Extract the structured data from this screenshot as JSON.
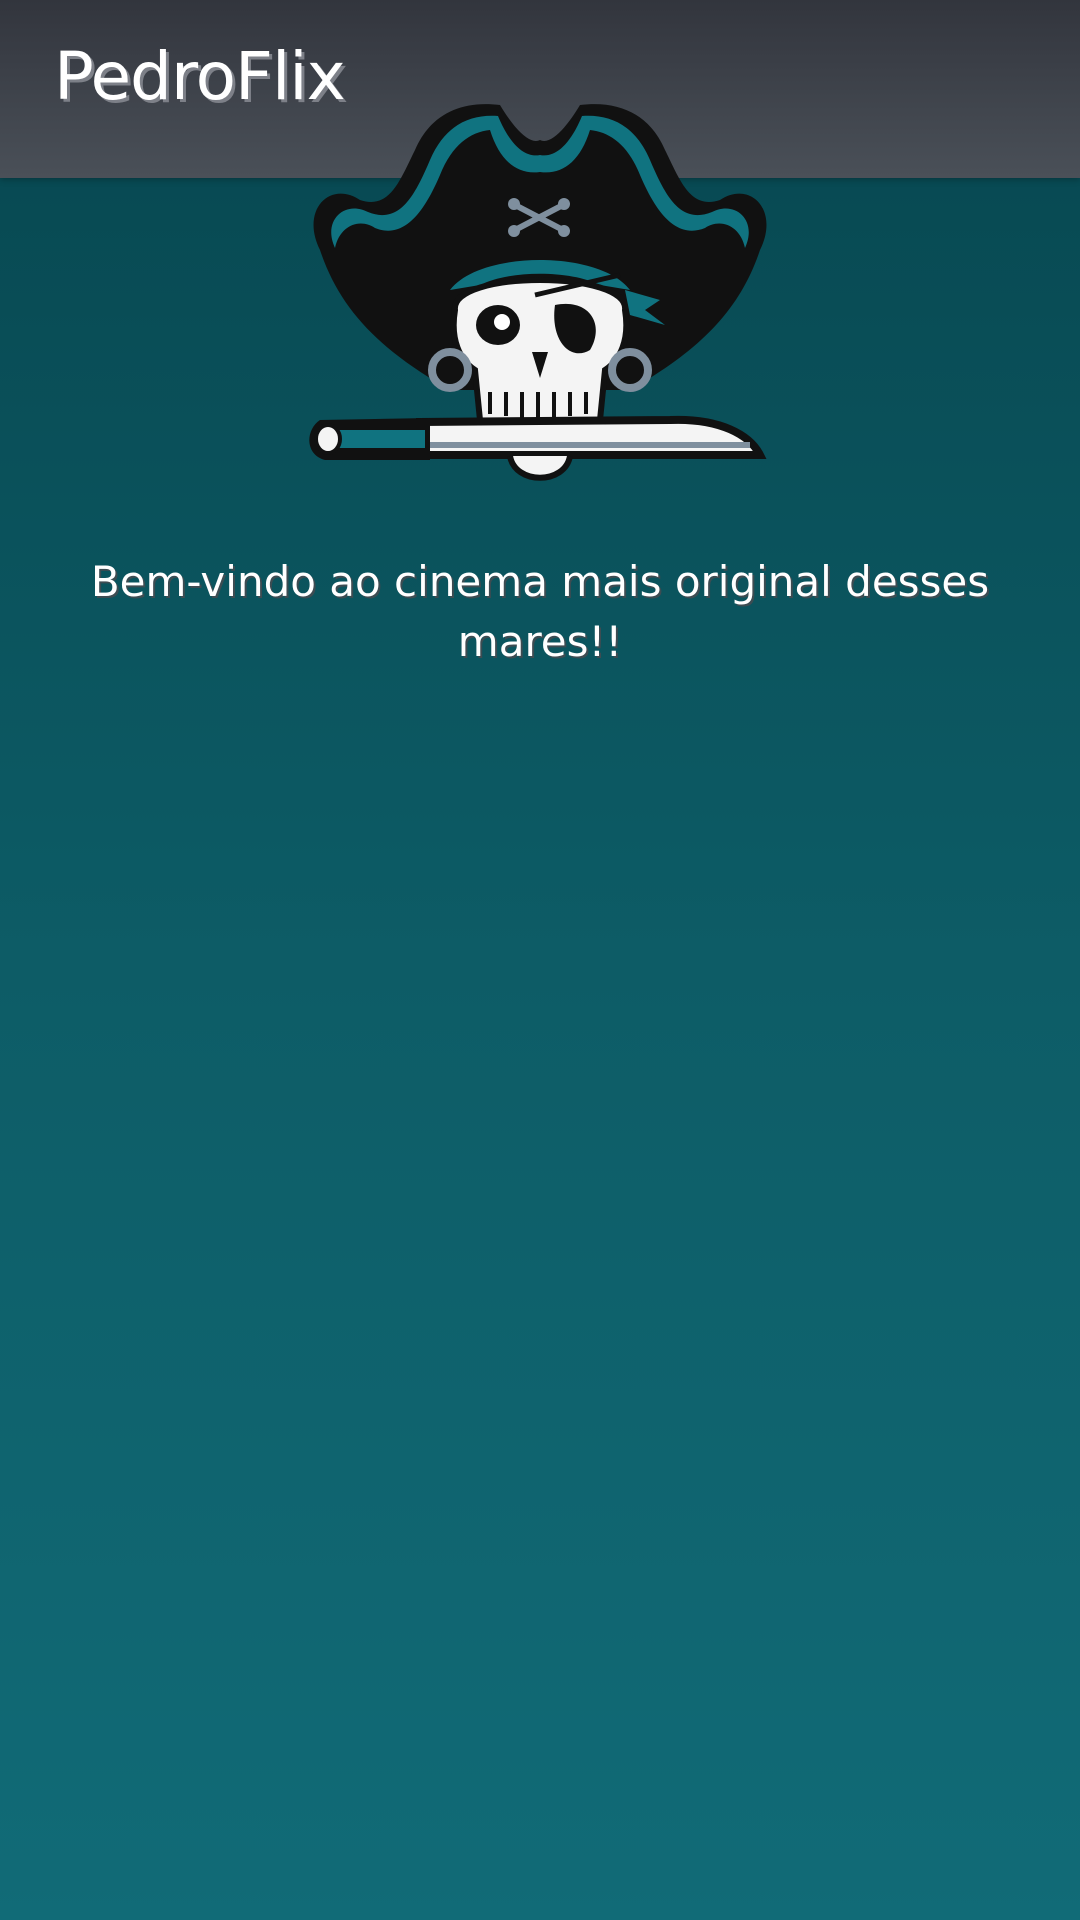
{
  "header": {
    "brand": "PedroFlix"
  },
  "hero": {
    "logo_icon": "pirate-skull-logo",
    "welcome_text": "Bem-vindo ao cinema mais original desses mares!!"
  },
  "colors": {
    "header_bg": "#3a3e46",
    "page_bg_top": "#07464f",
    "page_bg_bottom": "#116b77",
    "accent_teal": "#107380",
    "text": "#ffffff"
  }
}
